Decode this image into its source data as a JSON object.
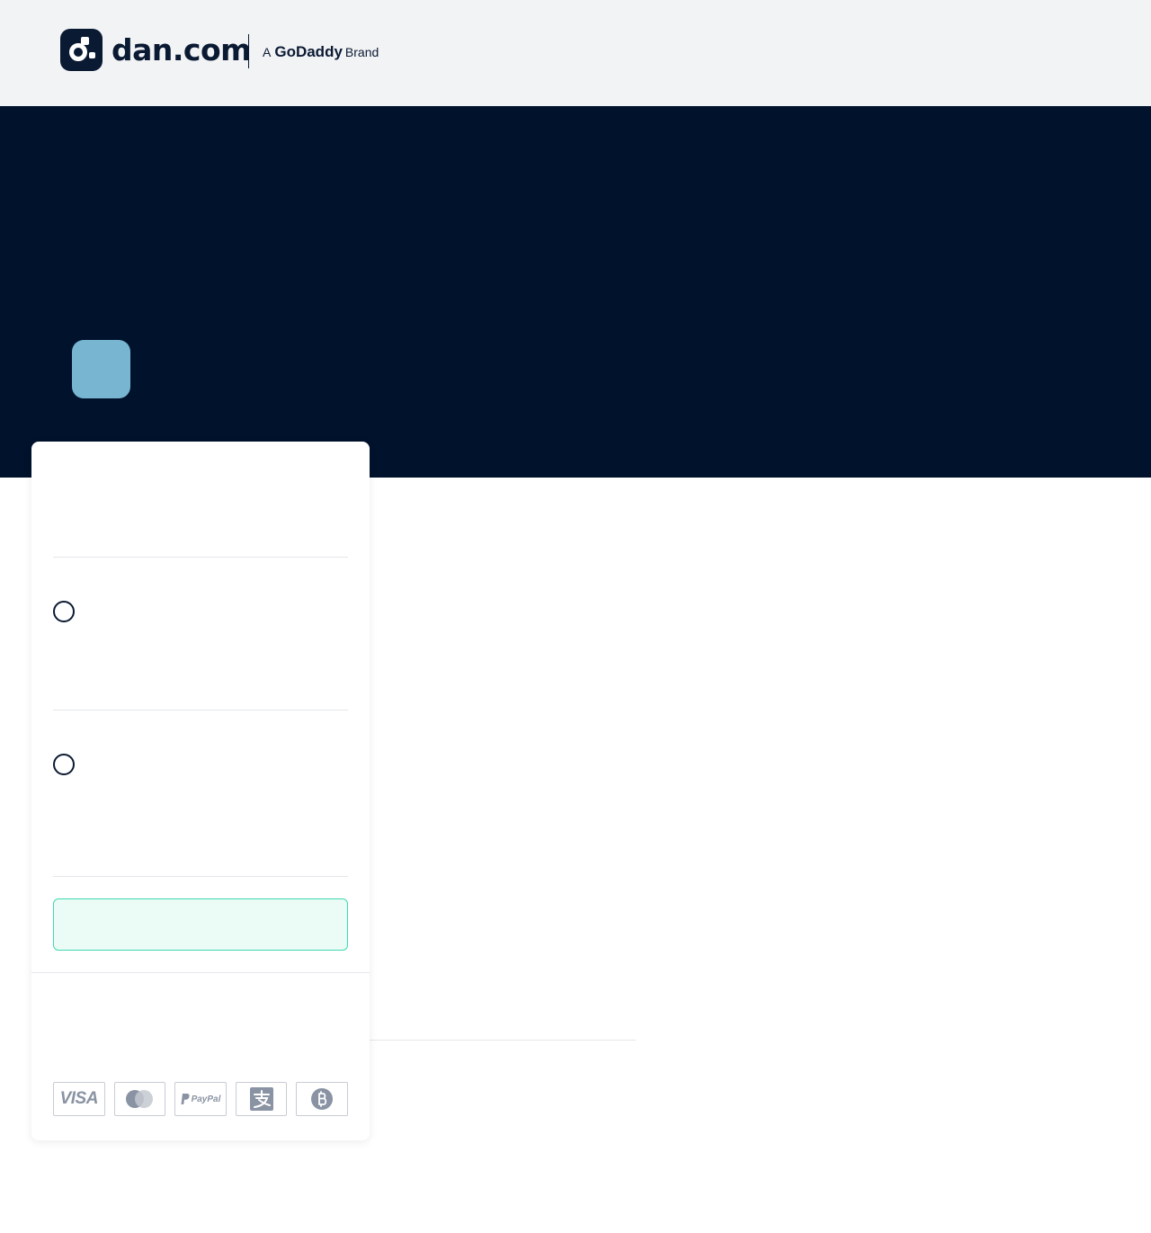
{
  "header": {
    "logo_text": "dan.com",
    "brand_prefix": "A",
    "brand_name": "GoDaddy",
    "brand_suffix": "Brand"
  },
  "payment_methods": {
    "visa": "VISA",
    "paypal": "PayPal",
    "icons": [
      "visa-icon",
      "mastercard-icon",
      "paypal-icon",
      "alipay-icon",
      "bitcoin-icon"
    ]
  },
  "colors": {
    "hero_background": "#00122c",
    "header_background": "#f2f3f5",
    "avatar": "#78b5d1",
    "cta_background": "#ebfcf6",
    "cta_border": "#3fd9b0"
  }
}
